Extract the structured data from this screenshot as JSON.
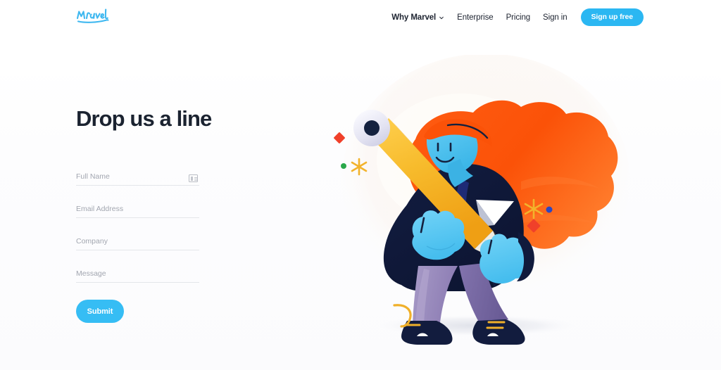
{
  "brand": {
    "logo_text": "Marvel",
    "logo_color": "#3fb8f0"
  },
  "nav": {
    "items": [
      {
        "label": "Why Marvel",
        "has_chevron": true,
        "bold": true
      },
      {
        "label": "Enterprise",
        "has_chevron": false,
        "bold": false
      },
      {
        "label": "Pricing",
        "has_chevron": false,
        "bold": false
      },
      {
        "label": "Sign in",
        "has_chevron": false,
        "bold": false
      }
    ],
    "cta": {
      "label": "Sign up free",
      "color": "#2bb7f2"
    }
  },
  "contact_form": {
    "heading": "Drop us a line",
    "fields": [
      {
        "name": "full-name",
        "placeholder": "Full Name",
        "value": "",
        "icon": "contact-card-icon"
      },
      {
        "name": "email",
        "placeholder": "Email Address",
        "value": "",
        "icon": null
      },
      {
        "name": "company",
        "placeholder": "Company",
        "value": "",
        "icon": null
      },
      {
        "name": "message",
        "placeholder": "Message",
        "value": "",
        "icon": null
      }
    ],
    "submit": {
      "label": "Submit",
      "color": "#36bdf4"
    }
  },
  "illustration": {
    "name": "person-holding-giant-pencil",
    "colors": {
      "hair": "#fb5e10",
      "skin": "#4ec3f0",
      "jacket": "#101a3c",
      "trousers": "#8b7bb5",
      "pencil": "#f5b32a",
      "shoes": "#0f1a3a",
      "eraser": "#ddddf0",
      "backdrop": "#fbf8f5"
    },
    "accents": [
      {
        "name": "red-diamond-left",
        "color": "#f0402a"
      },
      {
        "name": "green-dot-left",
        "color": "#2aa84a"
      },
      {
        "name": "yellow-sparkle-left",
        "color": "#f5b32a"
      },
      {
        "name": "yellow-sparkle-right",
        "color": "#f5b32a"
      },
      {
        "name": "blue-dot-right",
        "color": "#2b47c4"
      },
      {
        "name": "red-diamond-right",
        "color": "#f0402a"
      }
    ]
  }
}
